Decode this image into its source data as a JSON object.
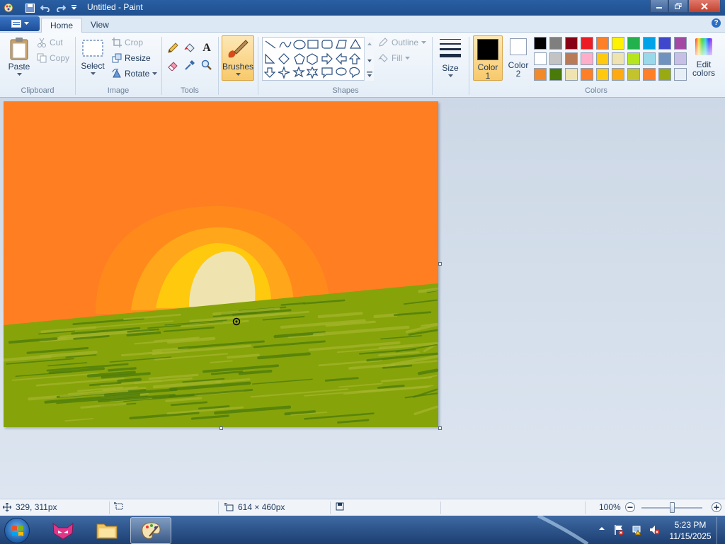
{
  "window": {
    "title": "Untitled - Paint"
  },
  "tabs": {
    "file_menu": "File menu",
    "home": "Home",
    "view": "View"
  },
  "clipboard": {
    "paste": "Paste",
    "cut": "Cut",
    "copy": "Copy",
    "group": "Clipboard"
  },
  "image": {
    "select": "Select",
    "crop": "Crop",
    "resize": "Resize",
    "rotate": "Rotate",
    "group": "Image"
  },
  "tools": {
    "group": "Tools",
    "text_glyph": "A"
  },
  "brushes": {
    "label": "Brushes"
  },
  "shapes": {
    "outline": "Outline",
    "fill": "Fill",
    "group": "Shapes"
  },
  "size": {
    "label": "Size"
  },
  "colors": {
    "color1_label": "Color",
    "color1_num": "1",
    "color2_label": "Color",
    "color2_num": "2",
    "edit_label": "Edit",
    "edit_label2": "colors",
    "group": "Colors",
    "color1_value": "#000000",
    "color2_value": "#ffffff",
    "palette": [
      "#000000",
      "#7f7f7f",
      "#880015",
      "#ed1c24",
      "#ff7f27",
      "#fff200",
      "#22b14c",
      "#00a2e8",
      "#3f48cc",
      "#a349a4",
      "#ffffff",
      "#c3c3c3",
      "#b97a57",
      "#ffaec9",
      "#ffc90e",
      "#efe4b0",
      "#b5e61d",
      "#99d9ea",
      "#7092be",
      "#c8bfe7",
      "#f28a2a",
      "#4a7a0a",
      "#efe4b0",
      "#ff7f27",
      "#ffc90e",
      "#ffaa11",
      "#c3c32d",
      "#ff7f27",
      "#99aa11",
      "#e8eef5"
    ]
  },
  "painting": {
    "sky": "#ff7e22",
    "sun_outer": "#ff8c1a",
    "sun_mid": "#ffa61a",
    "sun_inner": "#ffc90e",
    "sun_core": "#efe4b0",
    "grass": "#86a30a",
    "grass_dark": "#4a7a0a",
    "grass_light": "#a4b52a"
  },
  "status": {
    "cursor_pos": "329, 311px",
    "canvas_size": "614 × 460px",
    "zoom": "100%"
  },
  "taskbar": {
    "time": "5:23 PM",
    "date": "11/15/2025"
  }
}
